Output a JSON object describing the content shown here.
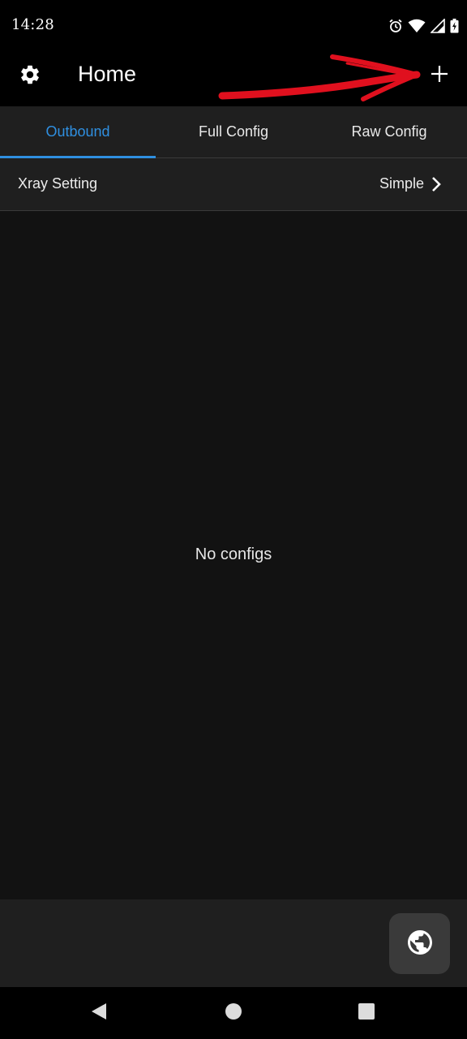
{
  "status_bar": {
    "time": "14:28",
    "icons": [
      "alarm-icon",
      "wifi-icon",
      "signal-icon",
      "battery-charging-icon"
    ]
  },
  "app_bar": {
    "title": "Home",
    "left_icon": "gear-icon",
    "right_icon": "plus-icon",
    "annotation": "red-arrow-icon"
  },
  "tabs": [
    {
      "label": "Outbound",
      "active": true
    },
    {
      "label": "Full Config",
      "active": false
    },
    {
      "label": "Raw Config",
      "active": false
    }
  ],
  "setting": {
    "label": "Xray Setting",
    "value": "Simple",
    "icon": "chevron-right-icon"
  },
  "empty_state": {
    "message": "No configs"
  },
  "fab": {
    "icon": "globe-icon"
  },
  "navigation": {
    "icons": [
      "back-triangle-icon",
      "home-circle-icon",
      "recents-square-icon"
    ]
  },
  "colors": {
    "background": "#121212",
    "surface": "#1f1f1f",
    "bar": "#000000",
    "accent": "#2f8fe0",
    "annotation_red": "#e0101e",
    "fab": "#3a3a3a"
  }
}
